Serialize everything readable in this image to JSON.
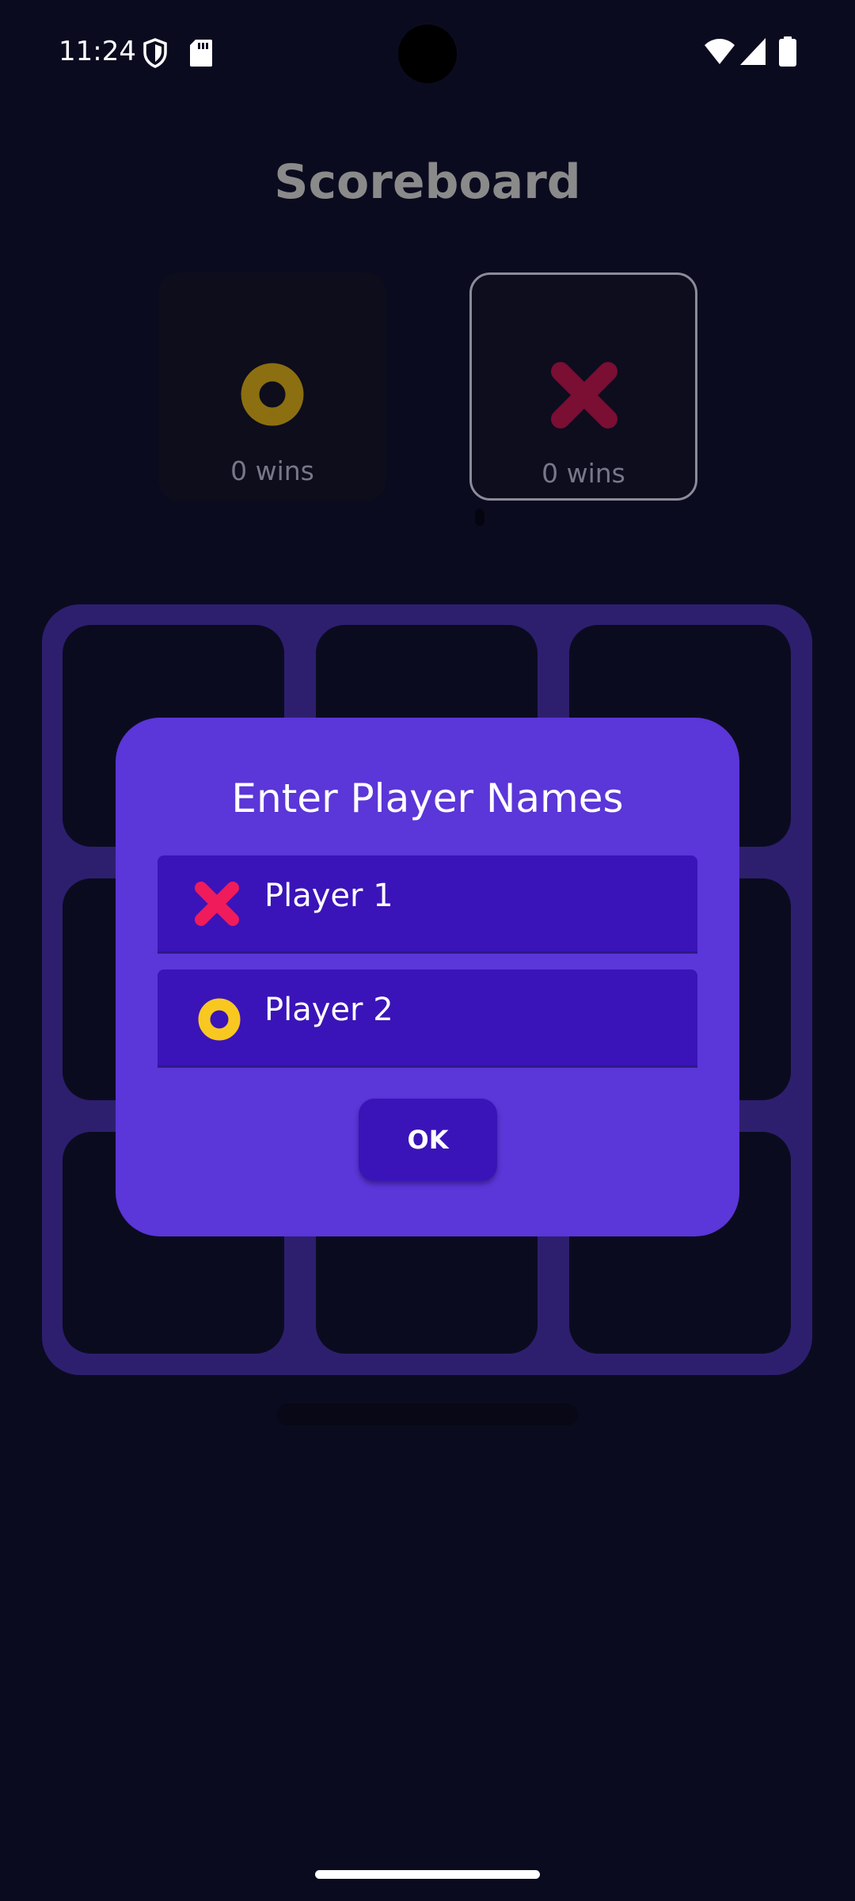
{
  "status_bar": {
    "time": "11:24",
    "icons": [
      "shield-icon",
      "sd-card-icon",
      "wifi-icon",
      "cellular-signal-icon",
      "battery-icon"
    ]
  },
  "scoreboard": {
    "title": "Scoreboard",
    "players": [
      {
        "symbol": "o-symbol-icon",
        "wins": "0 wins",
        "active": false
      },
      {
        "symbol": "x-symbol-icon",
        "wins": "0 wins",
        "active": true
      }
    ]
  },
  "board": {
    "rows": 3,
    "columns": 3
  },
  "dialog": {
    "title": "Enter Player Names",
    "fields": [
      {
        "symbol": "x-symbol-icon",
        "value": "Player 1"
      },
      {
        "symbol": "o-symbol-icon",
        "value": "Player 2"
      }
    ],
    "ok_label": "OK"
  },
  "colors": {
    "background": "#0b0b20",
    "board": "#2d1f6e",
    "dialog": "#5b36d8",
    "field": "#3a14b8",
    "x_symbol": "#f01b5a",
    "o_symbol": "#f9c820",
    "x_symbol_dimmed": "#7a0e33",
    "o_symbol_dimmed": "#8c6f10"
  }
}
